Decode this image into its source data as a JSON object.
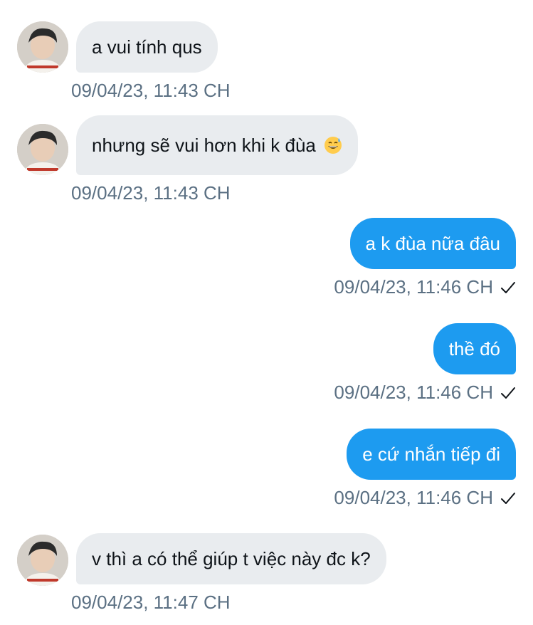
{
  "messages": [
    {
      "direction": "incoming",
      "text": "a vui tính qus",
      "timestamp": "09/04/23, 11:43 CH"
    },
    {
      "direction": "incoming",
      "text": "nhưng sẽ vui hơn khi k đùa",
      "emoji": "grinning-sweat-emoji",
      "timestamp": "09/04/23, 11:43 CH"
    },
    {
      "direction": "outgoing",
      "text": "a k đùa nữa đâu",
      "timestamp": "09/04/23, 11:46 CH",
      "status_icon": "check-icon"
    },
    {
      "direction": "outgoing",
      "text": "thề đó",
      "timestamp": "09/04/23, 11:46 CH",
      "status_icon": "check-icon"
    },
    {
      "direction": "outgoing",
      "text": "e cứ nhắn tiếp đi",
      "timestamp": "09/04/23, 11:46 CH",
      "status_icon": "check-icon"
    },
    {
      "direction": "incoming",
      "text": "v thì a có thể giúp t việc này đc k?",
      "timestamp": "09/04/23, 11:47 CH"
    }
  ],
  "colors": {
    "outgoing_bubble": "#1d9bf0",
    "incoming_bubble": "#e9ecef",
    "timestamp_text": "#5b7083"
  }
}
